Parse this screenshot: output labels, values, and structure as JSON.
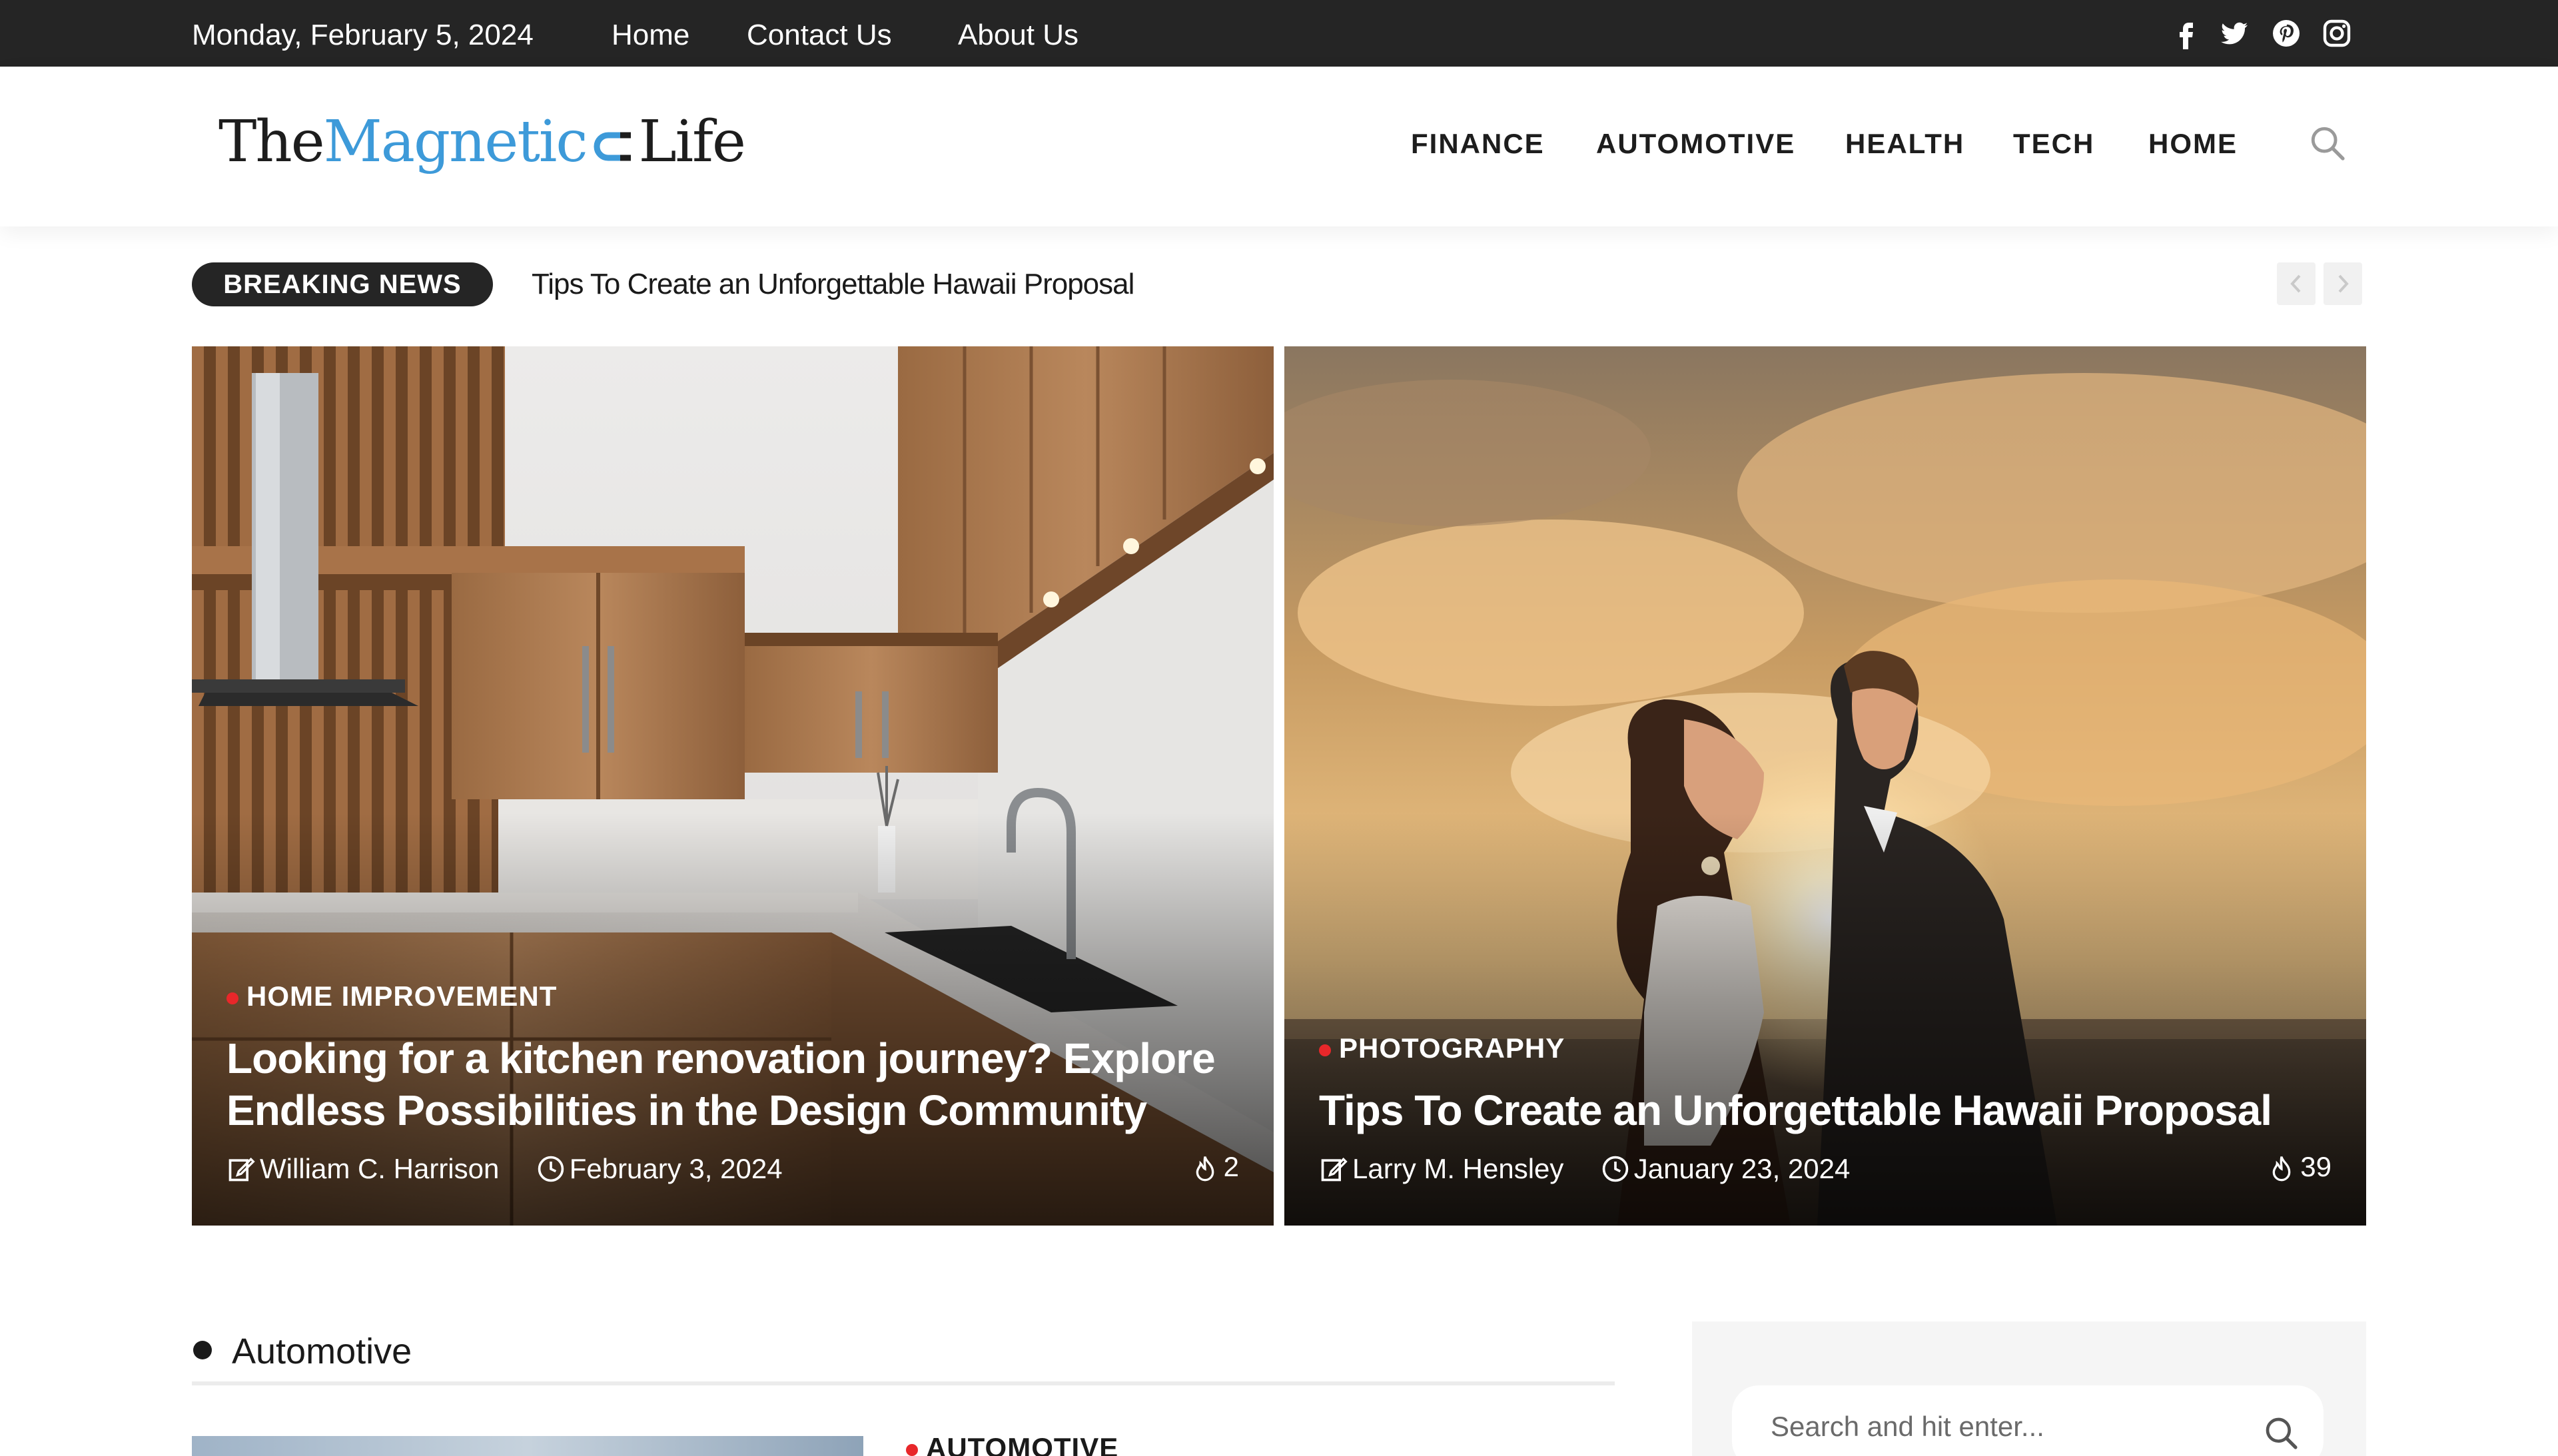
{
  "topbar": {
    "date": "Monday, February 5, 2024",
    "links": [
      "Home",
      "Contact Us",
      "About Us"
    ],
    "social_icons": [
      "facebook-icon",
      "twitter-icon",
      "pinterest-icon",
      "instagram-icon"
    ]
  },
  "header": {
    "logo": {
      "part1": "The",
      "part2": "Magnetic",
      "part3": "Life"
    },
    "nav": [
      "FINANCE",
      "AUTOMOTIVE",
      "HEALTH",
      "TECH",
      "HOME"
    ],
    "search_icon": "search-icon"
  },
  "breaking": {
    "label": "BREAKING NEWS",
    "headline": "Tips To Create an Unforgettable Hawaii Proposal"
  },
  "hero": [
    {
      "category": "HOME IMPROVEMENT",
      "title_line1": "Looking for a kitchen renovation journey? Explore",
      "title_line2": "Endless Possibilities in the Design Community",
      "author": "William C. Harrison",
      "date": "February 3, 2024",
      "count": "2"
    },
    {
      "category": "PHOTOGRAPHY",
      "title": "Tips To Create an Unforgettable Hawaii Proposal",
      "author": "Larry M. Hensley",
      "date": "January 23, 2024",
      "count": "39"
    }
  ],
  "section": {
    "title": "Automotive",
    "first_category": "AUTOMOTIVE"
  },
  "sidebar": {
    "search_placeholder": "Search and hit enter..."
  },
  "colors": {
    "topbar_bg": "#252525",
    "accent_blue": "#3d9ad9",
    "category_dot": "#e8272a"
  }
}
